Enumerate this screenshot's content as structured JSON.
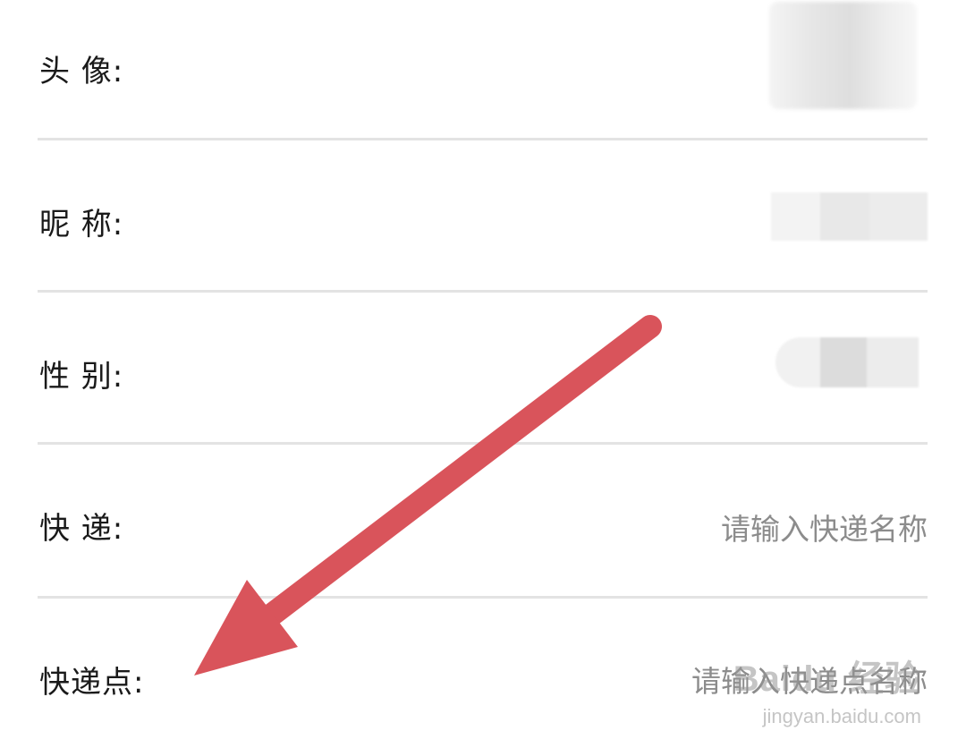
{
  "form": {
    "avatar_label": "头 像:",
    "nickname_label": "昵 称:",
    "gender_label": "性 别:",
    "courier_label": "快 递:",
    "courier_placeholder": "请输入快递名称",
    "courier_point_label": "快递点:",
    "courier_point_placeholder": "请输入快递点名称"
  },
  "watermark": {
    "brand": "Baidu 经验",
    "url": "jingyan.baidu.com"
  },
  "colors": {
    "arrow": "#d9545b",
    "divider": "#e3e3e3",
    "placeholder": "#8c8c8c"
  }
}
